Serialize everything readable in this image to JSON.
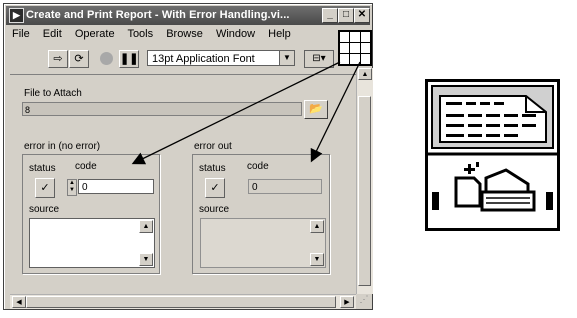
{
  "window": {
    "title": "Create and Print Report - With Error Handling.vi...",
    "controls": {
      "minimize": "_",
      "maximize": "□",
      "close": "✕"
    }
  },
  "menubar": [
    "File",
    "Edit",
    "Operate",
    "Tools",
    "Browse",
    "Window",
    "Help"
  ],
  "toolbar": {
    "run_icon": "run-arrow-icon",
    "run_continuous_icon": "run-continuously-icon",
    "abort_icon": "abort-icon",
    "pause_icon": "pause-icon",
    "font_select": "13pt Application Font",
    "align_icon": "align-objects-icon"
  },
  "front_panel": {
    "file_label": "File to Attach",
    "file_path_prefix": "8",
    "error_in": {
      "title": "error in (no error)",
      "status_label": "status",
      "code_label": "code",
      "code_value": "0",
      "source_label": "source"
    },
    "error_out": {
      "title": "error out",
      "status_label": "status",
      "code_label": "code",
      "code_value": "0",
      "source_label": "source"
    }
  },
  "colors": {
    "window_bg": "#d4d0c8",
    "title_bar": "#4a4a4a",
    "arrow": "#000000"
  }
}
